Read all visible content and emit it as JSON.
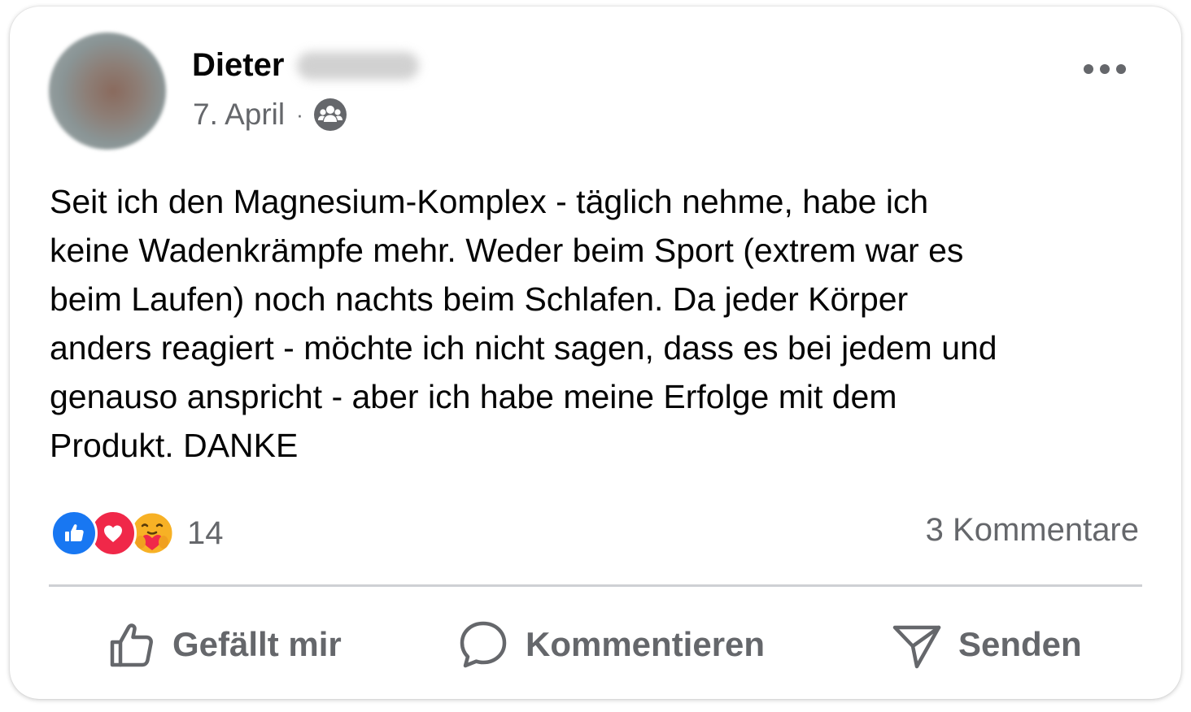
{
  "post": {
    "author_first_name": "Dieter",
    "date": "7. April",
    "separator": "·",
    "privacy_icon": "group-icon",
    "more_icon": "more-options-icon",
    "body_lines": [
      "Seit ich den Magnesium-Komplex - täglich nehme, habe ich",
      "keine Wadenkrämpfe mehr. Weder beim Sport (extrem war es",
      "beim Laufen) noch nachts beim Schlafen. Da jeder Körper",
      "anders reagiert - möchte ich nicht sagen, dass es bei jedem und",
      "genauso anspricht - aber ich habe meine Erfolge mit dem",
      "Produkt. DANKE"
    ]
  },
  "reactions": {
    "types": [
      "like",
      "love",
      "care"
    ],
    "count": "14",
    "comments": "3 Kommentare"
  },
  "actions": {
    "like_label": "Gefällt mir",
    "comment_label": "Kommentieren",
    "send_label": "Senden"
  },
  "colors": {
    "like_blue": "#1877f2",
    "love_red": "#f02849",
    "care_yellow": "#f7b125",
    "secondary_text": "#65676b",
    "primary_text": "#050505"
  }
}
